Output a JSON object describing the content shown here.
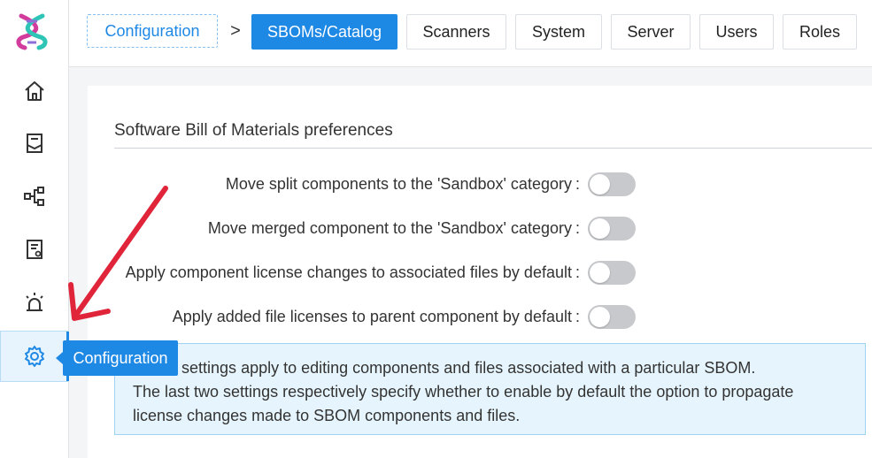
{
  "sidebar": {
    "items": [
      {
        "icon": "home-icon",
        "name": "home"
      },
      {
        "icon": "document-icon",
        "name": "sboms"
      },
      {
        "icon": "hierarchy-icon",
        "name": "structure"
      },
      {
        "icon": "report-icon",
        "name": "reports"
      },
      {
        "icon": "alarm-icon",
        "name": "alerts"
      },
      {
        "icon": "gear-icon",
        "name": "configuration"
      }
    ],
    "tooltip": "Configuration"
  },
  "breadcrumb": {
    "root": "Configuration",
    "separator": ">"
  },
  "tabs": [
    {
      "label": "SBOMs/Catalog",
      "active": true
    },
    {
      "label": "Scanners",
      "active": false
    },
    {
      "label": "System",
      "active": false
    },
    {
      "label": "Server",
      "active": false
    },
    {
      "label": "Users",
      "active": false
    },
    {
      "label": "Roles",
      "active": false
    }
  ],
  "section": {
    "title": "Software Bill of Materials preferences"
  },
  "preferences": [
    {
      "label": "Move split components to the 'Sandbox' category",
      "enabled": false
    },
    {
      "label": "Move merged component to the 'Sandbox' category",
      "enabled": false
    },
    {
      "label": "Apply component license changes to associated files by default",
      "enabled": false
    },
    {
      "label": "Apply added file licenses to parent component by default",
      "enabled": false
    }
  ],
  "info": {
    "line1": "These settings apply to editing components and files associated with a particular SBOM.",
    "line2": "The last two settings respectively specify whether to enable by default the option to propagate",
    "line3": "license changes made to SBOM components and files."
  },
  "colors": {
    "accent": "#1e88e5",
    "annotation_arrow": "#e0243a"
  }
}
